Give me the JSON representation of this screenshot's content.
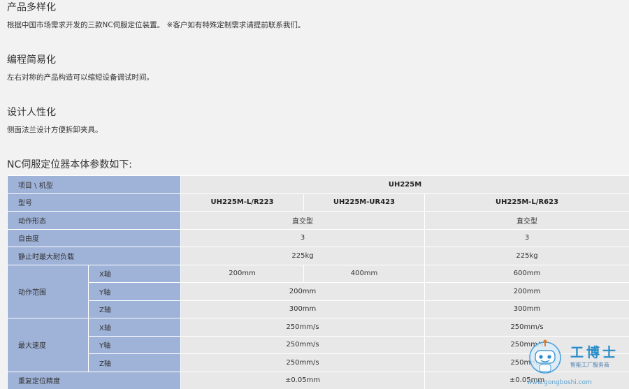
{
  "sections": [
    {
      "title": "产品多样化",
      "desc": "根据中国市场需求开发的三款NC伺服定位装置。 ※客户如有特殊定制需求请提前联系我们。"
    },
    {
      "title": "编程简易化",
      "desc": "左右对称的产品构造可以缩短设备调试时间。"
    },
    {
      "title": "设计人性化",
      "desc": "侧面法兰设计方便拆卸夹具。"
    }
  ],
  "table": {
    "title": "NC伺服定位器本体参数如下:",
    "header_item": "项目 \\ 机型",
    "series": "UH225M",
    "model_label": "型号",
    "models": [
      "UH225M-L/R223",
      "UH225M-UR423",
      "UH225M-L/R623"
    ],
    "rows": {
      "motion_form": {
        "label": "动作形态",
        "v1": "直交型",
        "v2": "直交型"
      },
      "dof": {
        "label": "自由度",
        "v1": "3",
        "v2": "3"
      },
      "max_load": {
        "label": "静止时最大耐负载",
        "v1": "225kg",
        "v2": "225kg"
      },
      "range": {
        "label": "动作范围",
        "x": {
          "axis": "X轴",
          "a": "200mm",
          "b": "400mm",
          "c": "600mm"
        },
        "y": {
          "axis": "Y轴",
          "v1": "200mm",
          "v2": "200mm"
        },
        "z": {
          "axis": "Z轴",
          "v1": "300mm",
          "v2": "300mm"
        }
      },
      "speed": {
        "label": "最大速度",
        "x": {
          "axis": "X轴",
          "v1": "250mm/s",
          "v2": "250mm/s"
        },
        "y": {
          "axis": "Y轴",
          "v1": "250mm/s",
          "v2": "250mm/s"
        },
        "z": {
          "axis": "Z轴",
          "v1": "250mm/s",
          "v2": "250mm/s"
        }
      },
      "repeat": {
        "label": "重复定位精度",
        "v1": "±0.05mm",
        "v2": "±0.05mm"
      }
    }
  },
  "watermark": {
    "brand": "工博士",
    "tagline": "智能工厂服务商",
    "url": "www.gongboshi.com"
  },
  "colors": {
    "background": "#f2f2f2",
    "header_cell": "#9fb2d8",
    "data_cell": "#e8e8e8",
    "brand_blue": "#2a8cc8"
  }
}
